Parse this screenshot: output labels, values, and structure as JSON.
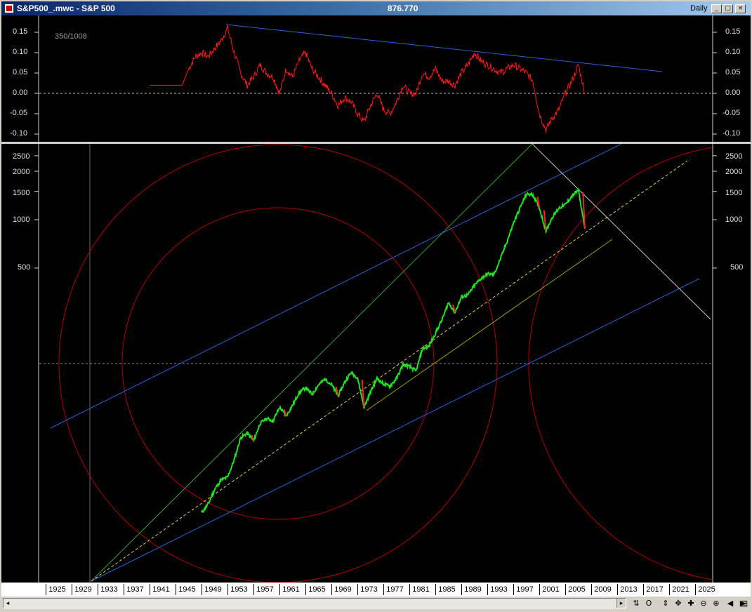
{
  "window": {
    "title": "S&P500_.mwc - S&P 500",
    "price": "876.770",
    "period": "Daily",
    "buttons": {
      "minimize": "_",
      "maximize": "□",
      "close": "×"
    }
  },
  "upper_panel": {
    "counter": "350/1008",
    "y_ticks": [
      "0.15",
      "0.10",
      "0.05",
      "0.00",
      "-0.05",
      "-0.10"
    ]
  },
  "lower_panel": {
    "y_ticks": [
      "2500",
      "2000",
      "1500",
      "1000",
      "500"
    ]
  },
  "x_axis": {
    "ticks": [
      "1925",
      "1929",
      "1933",
      "1937",
      "1941",
      "1945",
      "1949",
      "1953",
      "1957",
      "1961",
      "1965",
      "1969",
      "1973",
      "1977",
      "1981",
      "1985",
      "1989",
      "1993",
      "1997",
      "2001",
      "2005",
      "2009",
      "2013",
      "2017",
      "2021",
      "2025"
    ]
  },
  "toolbar": {
    "icons": [
      "refresh-icon",
      "circle-icon",
      "vertical-move-icon",
      "pan-icon",
      "cross-icon",
      "zoom-out-icon",
      "zoom-in-icon",
      "arrow-left-icon",
      "arrow-right-icon",
      "menu-icon"
    ],
    "glyphs": [
      "⇅",
      "O",
      "⇕",
      "✥",
      "✚",
      "⊖",
      "⊕",
      "◀",
      "▶",
      "▤"
    ]
  },
  "colors": {
    "price_up": "#22e022",
    "price_down": "#ff2020",
    "oscillator": "#ff1a1a",
    "trend_blue": "#2e5fd8",
    "circle_red": "#b30000",
    "fan_green": "#3a9a3a",
    "midline_yellow": "#e8d040",
    "fan_white": "#c8c8c8"
  },
  "chart_data": [
    {
      "type": "line",
      "title": "",
      "ylim": [
        -0.11,
        0.17
      ],
      "y_ticks": [
        0.15,
        0.1,
        0.05,
        0.0,
        -0.05,
        -0.1
      ],
      "series": [
        {
          "x": [
            1941,
            1946,
            1947,
            1948,
            1949,
            1950,
            1951,
            1952,
            1953,
            1954,
            1955,
            1956,
            1957,
            1958,
            1959,
            1960,
            1961,
            1962,
            1963,
            1964,
            1965,
            1966,
            1967,
            1968,
            1969,
            1970,
            1971,
            1972,
            1973,
            1974,
            1975,
            1976,
            1977,
            1978,
            1979,
            1980,
            1981,
            1982,
            1983,
            1984,
            1985,
            1986,
            1987,
            1988,
            1989,
            1990,
            1991,
            1992,
            1993,
            1994,
            1995,
            1996,
            1997,
            1998,
            1999,
            2000,
            2001,
            2002,
            2003,
            2004,
            2005,
            2006,
            2007,
            2008
          ],
          "values": [
            0.02,
            0.02,
            0.06,
            0.09,
            0.1,
            0.09,
            0.11,
            0.13,
            0.16,
            0.1,
            0.05,
            0.02,
            0.04,
            0.07,
            0.05,
            0.04,
            0.0,
            0.06,
            0.04,
            0.08,
            0.1,
            0.06,
            0.04,
            0.02,
            0.0,
            -0.03,
            -0.01,
            -0.02,
            -0.05,
            -0.07,
            -0.03,
            0.0,
            -0.04,
            -0.05,
            -0.02,
            0.02,
            0.0,
            0.0,
            0.05,
            0.04,
            0.06,
            0.03,
            0.03,
            0.02,
            0.05,
            0.07,
            0.1,
            0.08,
            0.07,
            0.06,
            0.05,
            0.06,
            0.07,
            0.06,
            0.05,
            0.03,
            -0.05,
            -0.09,
            -0.06,
            -0.04,
            0.0,
            0.03,
            0.07,
            0.0
          ]
        }
      ],
      "reference_lines": [
        {
          "y": 0.0,
          "style": "dashed"
        }
      ]
    },
    {
      "type": "line",
      "title": "",
      "y_scale": "log",
      "ylim": [
        10,
        2800
      ],
      "y_ticks": [
        500,
        1000,
        1500,
        2000,
        2500
      ],
      "x_ticks": [
        1925,
        1929,
        1933,
        1937,
        1941,
        1945,
        1949,
        1953,
        1957,
        1961,
        1965,
        1969,
        1973,
        1977,
        1981,
        1985,
        1989,
        1993,
        1997,
        2001,
        2005,
        2009,
        2013,
        2017,
        2021,
        2025
      ],
      "xlim": [
        1924,
        2026
      ],
      "series": [
        {
          "x": [
            1949,
            1950,
            1951,
            1952,
            1953,
            1954,
            1955,
            1956,
            1957,
            1958,
            1959,
            1960,
            1961,
            1962,
            1963,
            1964,
            1965,
            1966,
            1967,
            1968,
            1969,
            1970,
            1971,
            1972,
            1973,
            1974,
            1975,
            1976,
            1977,
            1978,
            1979,
            1980,
            1981,
            1982,
            1983,
            1984,
            1985,
            1986,
            1987,
            1988,
            1989,
            1990,
            1991,
            1992,
            1993,
            1994,
            1995,
            1996,
            1997,
            1998,
            1999,
            2000,
            2001,
            2002,
            2003,
            2004,
            2005,
            2006,
            2007,
            2008
          ],
          "values": [
            15,
            17,
            21,
            24,
            25,
            32,
            44,
            47,
            42,
            54,
            58,
            56,
            68,
            60,
            70,
            84,
            90,
            82,
            94,
            102,
            94,
            80,
            97,
            112,
            104,
            68,
            85,
            103,
            95,
            92,
            103,
            125,
            122,
            114,
            158,
            163,
            197,
            238,
            305,
            265,
            330,
            340,
            390,
            430,
            460,
            455,
            570,
            730,
            950,
            1180,
            1440,
            1430,
            1180,
            850,
            1040,
            1180,
            1240,
            1400,
            1530,
            880
          ]
        }
      ]
    }
  ]
}
